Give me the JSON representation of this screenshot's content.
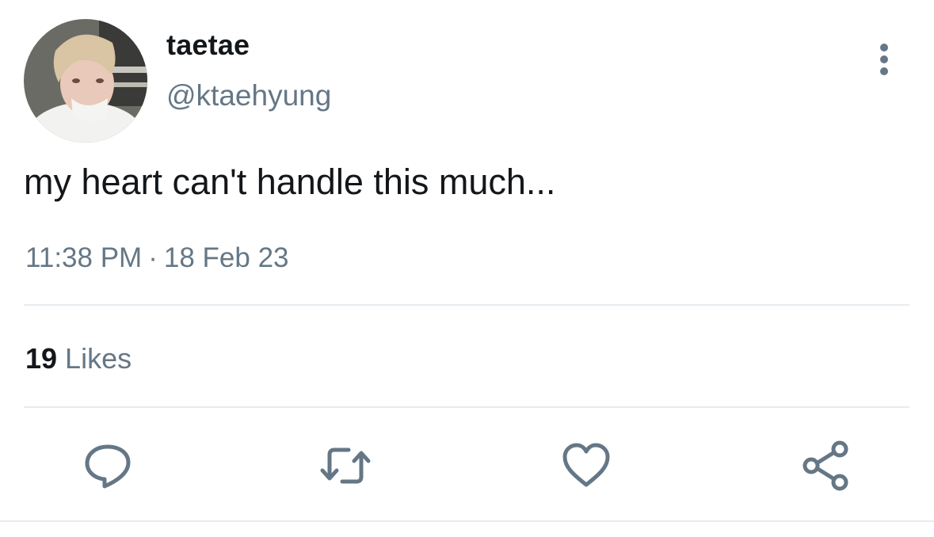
{
  "user": {
    "display_name": "taetae",
    "handle": "@ktaehyung",
    "avatar_icon": "profile-photo"
  },
  "tweet": {
    "text": "my heart can't handle this much...",
    "time": "11:38 PM",
    "separator": "·",
    "date": "18 Feb 23"
  },
  "stats": {
    "likes_count": "19",
    "likes_label": "Likes"
  },
  "actions": {
    "more_icon": "more-vertical-icon",
    "reply_icon": "reply-icon",
    "retweet_icon": "retweet-icon",
    "like_icon": "heart-icon",
    "share_icon": "share-icon"
  },
  "colors": {
    "text_primary": "#14171a",
    "text_secondary": "#657786",
    "divider": "#e6ecf0",
    "icon": "#657786"
  }
}
